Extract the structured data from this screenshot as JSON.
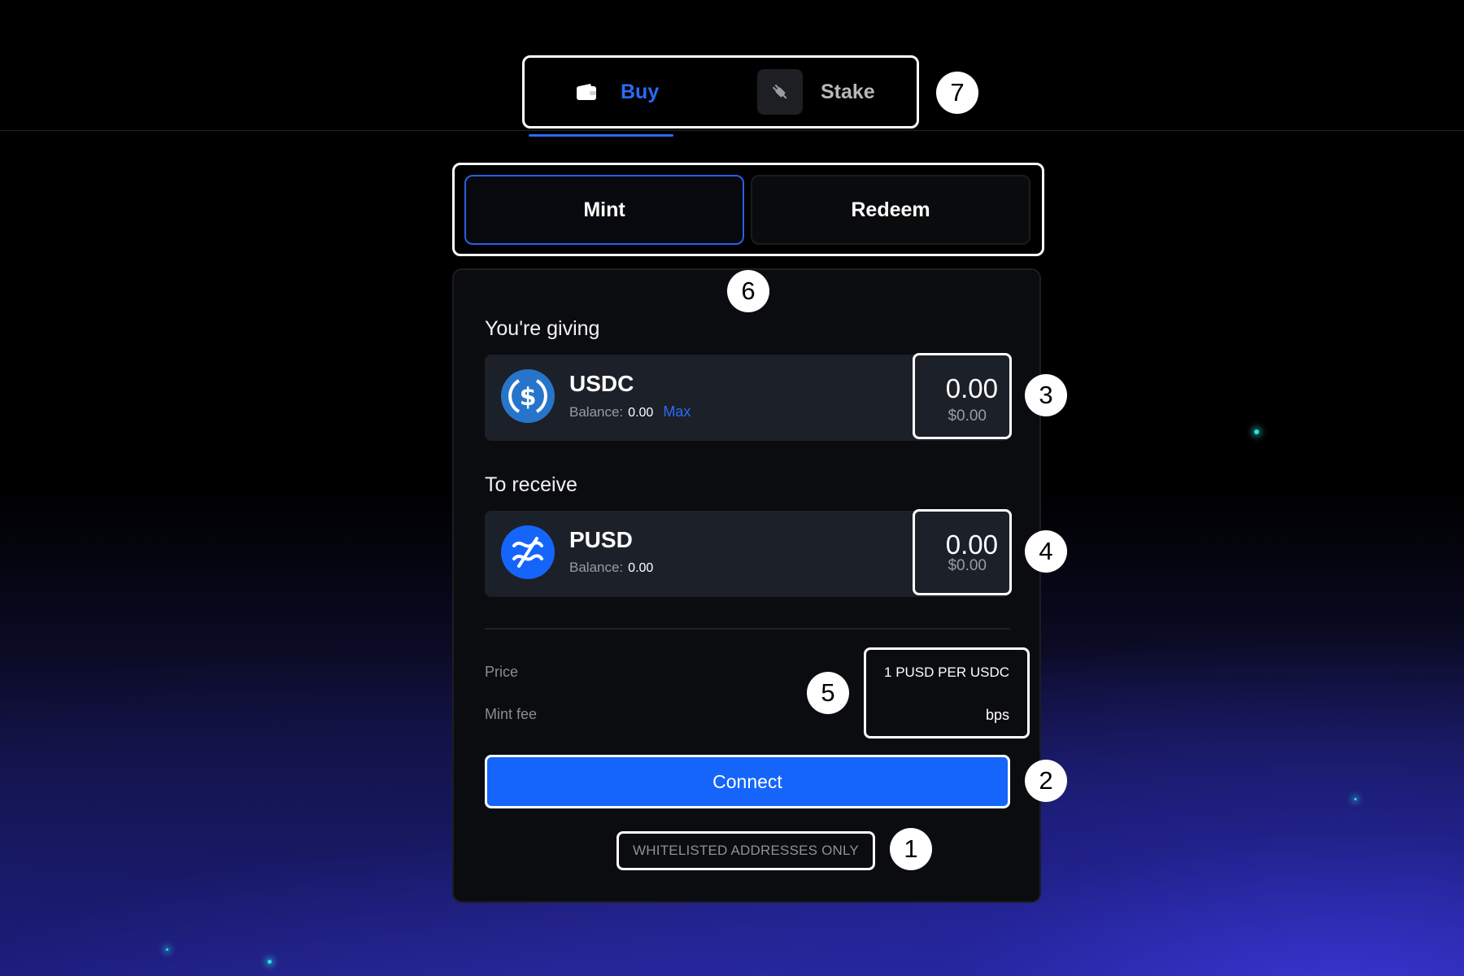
{
  "nav": {
    "tabs": [
      {
        "label": "Buy",
        "icon": "wallet-icon",
        "active": true
      },
      {
        "label": "Stake",
        "icon": "plug-icon",
        "active": false
      }
    ],
    "accent_color": "#2b6af5"
  },
  "mode": {
    "mint_label": "Mint",
    "redeem_label": "Redeem",
    "active": "Mint"
  },
  "giving": {
    "label": "You're giving",
    "token": "USDC",
    "balance_label": "Balance:",
    "balance": "0.00",
    "max_label": "Max",
    "amount": "0.00",
    "amount_usd": "$0.00",
    "icon": "usdc-icon"
  },
  "receive": {
    "label": "To receive",
    "token": "PUSD",
    "balance_label": "Balance:",
    "balance": "0.00",
    "amount": "0.00",
    "amount_usd": "$0.00",
    "icon": "pusd-icon"
  },
  "info": {
    "price_label": "Price",
    "price_value": "1 PUSD PER USDC",
    "fee_label": "Mint fee",
    "fee_value": "bps"
  },
  "connect_label": "Connect",
  "connect_color": "#1565fb",
  "whitelist_text": "WHITELISTED ADDRESSES ONLY",
  "badges": [
    "1",
    "2",
    "3",
    "4",
    "5",
    "6",
    "7"
  ]
}
